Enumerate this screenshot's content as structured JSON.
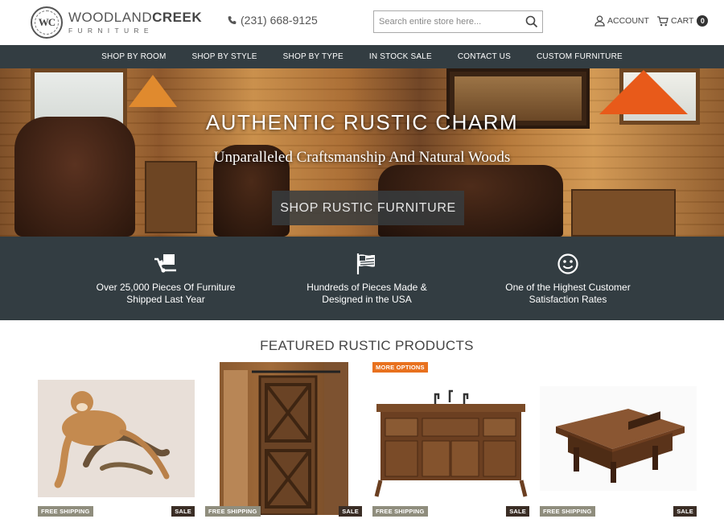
{
  "brand": {
    "monogram": "WC",
    "name_light": "WOODLAND",
    "name_bold": "CREEK",
    "tagline": "FURNITURE"
  },
  "header": {
    "phone": "(231) 668-9125",
    "search_placeholder": "Search entire store here...",
    "account_label": "ACCOUNT",
    "cart_label": "CART",
    "cart_count": "0"
  },
  "nav": {
    "items": [
      {
        "label": "SHOP BY ROOM"
      },
      {
        "label": "SHOP BY STYLE"
      },
      {
        "label": "SHOP BY TYPE"
      },
      {
        "label": "IN STOCK SALE"
      },
      {
        "label": "CONTACT US"
      },
      {
        "label": "CUSTOM FURNITURE"
      }
    ]
  },
  "hero": {
    "title": "AUTHENTIC RUSTIC CHARM",
    "subtitle": "Unparalleled Craftsmanship And Natural Woods",
    "cta": "SHOP RUSTIC FURNITURE"
  },
  "features": [
    {
      "icon": "shipping-dolly-icon",
      "line1": "Over 25,000 Pieces Of Furniture",
      "line2": "Shipped Last Year"
    },
    {
      "icon": "usa-flag-icon",
      "line1": "Hundreds of Pieces Made &",
      "line2": "Designed in the USA"
    },
    {
      "icon": "smiley-face-icon",
      "line1": "One of the Highest Customer",
      "line2": "Satisfaction Rates"
    }
  ],
  "featured": {
    "title": "FEATURED RUSTIC PRODUCTS",
    "products": [
      {
        "image": "mountain-lion-taxidermy",
        "badge_top": "",
        "badge_ship": "FREE SHIPPING",
        "badge_sale": "SALE"
      },
      {
        "image": "rustic-barn-door",
        "badge_top": "",
        "badge_ship": "FREE SHIPPING",
        "badge_sale": "SALE"
      },
      {
        "image": "reclaimed-wood-vanity",
        "badge_top": "MORE OPTIONS",
        "badge_ship": "FREE SHIPPING",
        "badge_sale": "SALE"
      },
      {
        "image": "rustic-coffee-table",
        "badge_top": "",
        "badge_ship": "FREE SHIPPING",
        "badge_sale": "SALE"
      }
    ]
  },
  "colors": {
    "nav_bg": "#333d42",
    "badge_ship": "#8f8d7d",
    "badge_sale": "#3a2d25",
    "badge_options": "#e8711e"
  }
}
